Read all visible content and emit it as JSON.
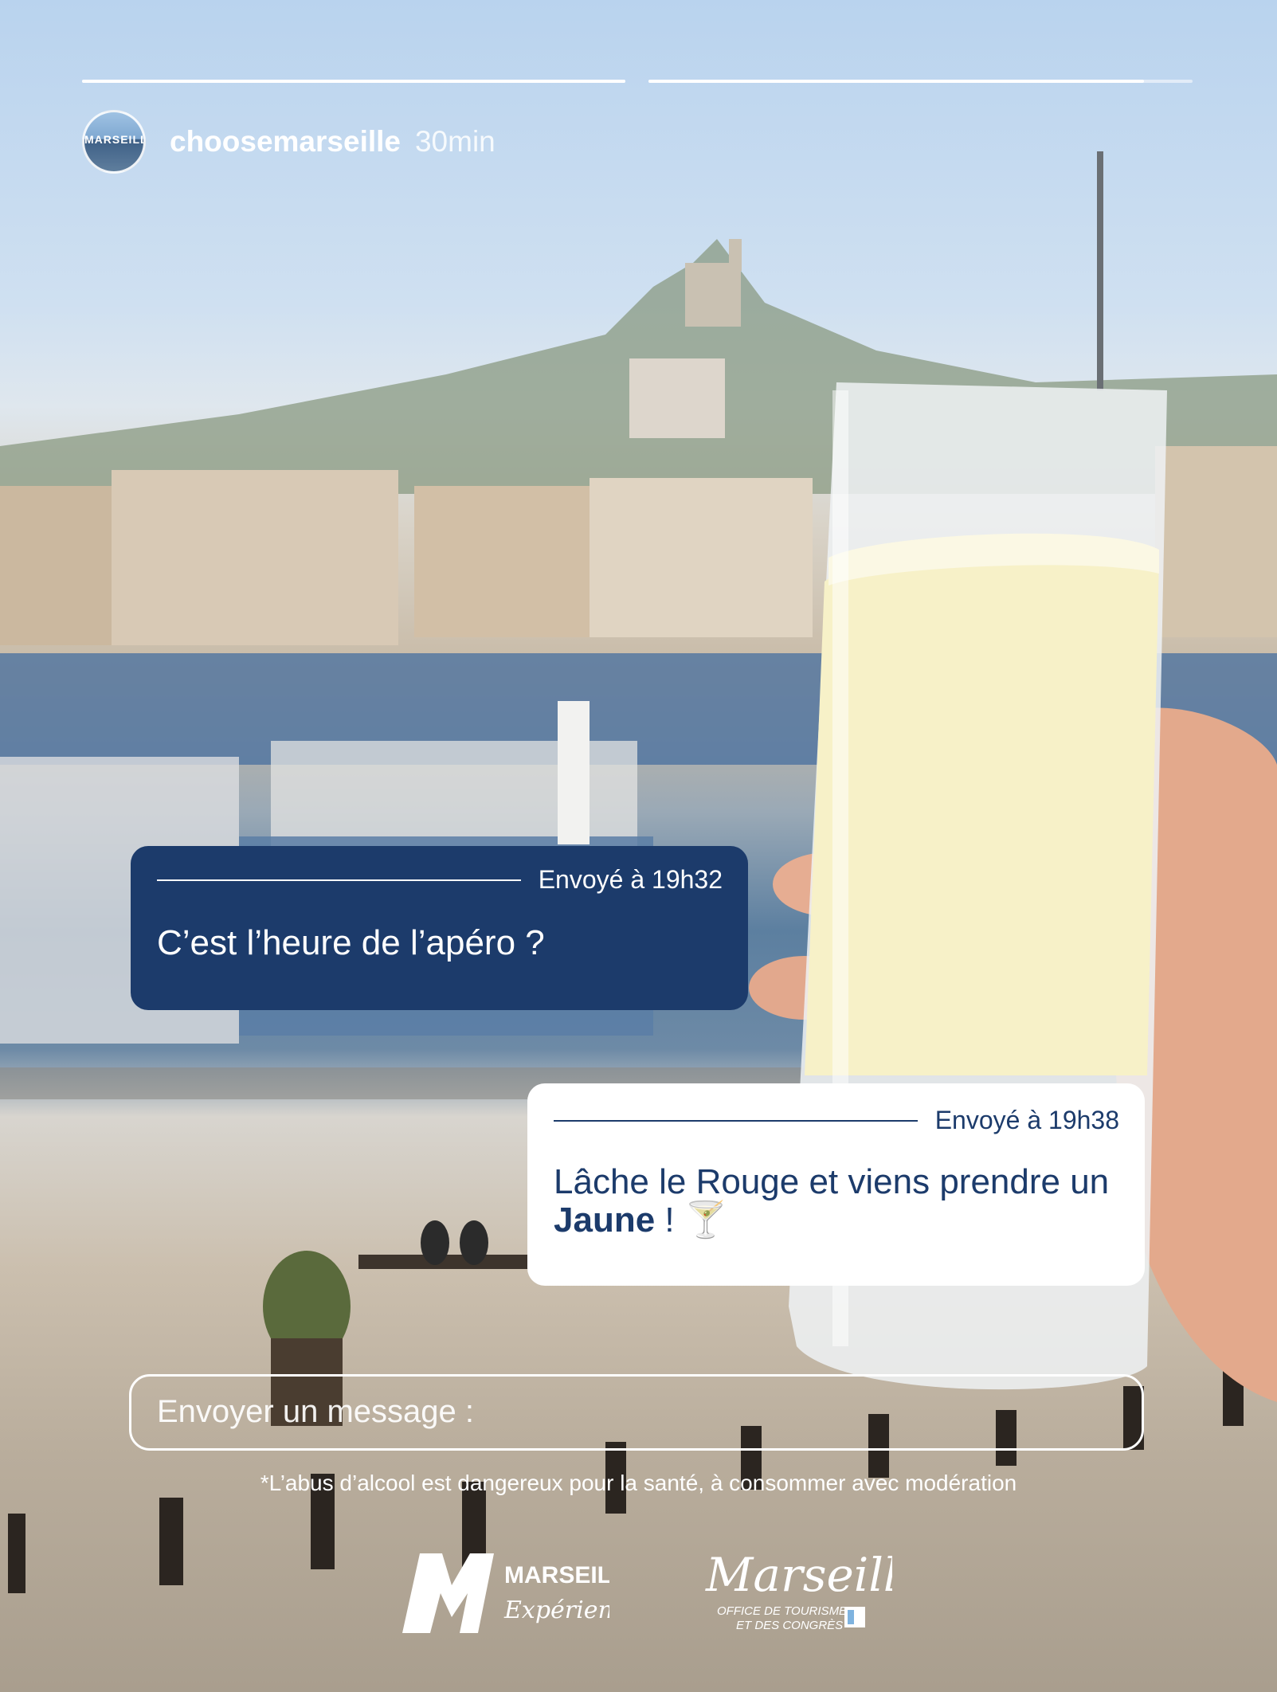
{
  "story": {
    "progress": [
      1.0,
      0.91
    ],
    "username": "choosemarseille",
    "time_ago": "30min",
    "avatar_text": "MARSEILLE"
  },
  "messages": [
    {
      "sent_time": "Envoyé à 19h32",
      "text": "C’est l’heure de l’apéro ?"
    },
    {
      "sent_time": "Envoyé à 19h38",
      "text_before": "Lâche le Rouge et viens prendre un ",
      "text_bold": "Jaune",
      "text_after": " ! ",
      "emoji": "🍸"
    }
  ],
  "composer": {
    "placeholder": "Envoyer un message :"
  },
  "disclaimer": "*L’abus d’alcool est dangereux pour la santé, à consommer avec modération",
  "logos": {
    "experience": {
      "main": "MARSEILLE",
      "script": "Expérience !"
    },
    "office": {
      "main": "Marseille",
      "sub1": "OFFICE DE TOURISME",
      "sub2": "ET DES CONGRÈS"
    }
  },
  "colors": {
    "bubble_dark": "#1c3b6b",
    "bubble_light": "#ffffff",
    "text_light": "#ffffff"
  }
}
